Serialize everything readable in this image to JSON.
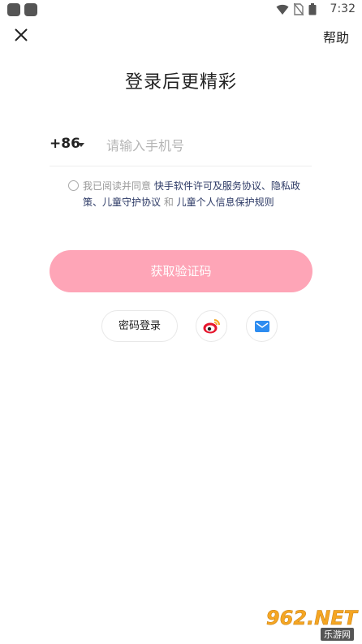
{
  "status_bar": {
    "time": "7:32"
  },
  "header": {
    "help_label": "帮助"
  },
  "title": "登录后更精彩",
  "phone": {
    "country_code": "+86",
    "placeholder": "请输入手机号"
  },
  "agreement": {
    "prefix": "我已阅读并同意 ",
    "link1": "快手软件许可及服务协议、隐私政策、儿童守护协议",
    "middle": " 和 ",
    "link2": "儿童个人信息保护规则"
  },
  "primary_button": "获取验证码",
  "alt_login": {
    "password_label": "密码登录"
  },
  "watermark": {
    "main": "962.NET",
    "sub": "乐游网"
  },
  "colors": {
    "primary": "#fea5b7",
    "link": "#2d3a66",
    "weibo": "#e6162d",
    "mail": "#2d8cf0"
  }
}
